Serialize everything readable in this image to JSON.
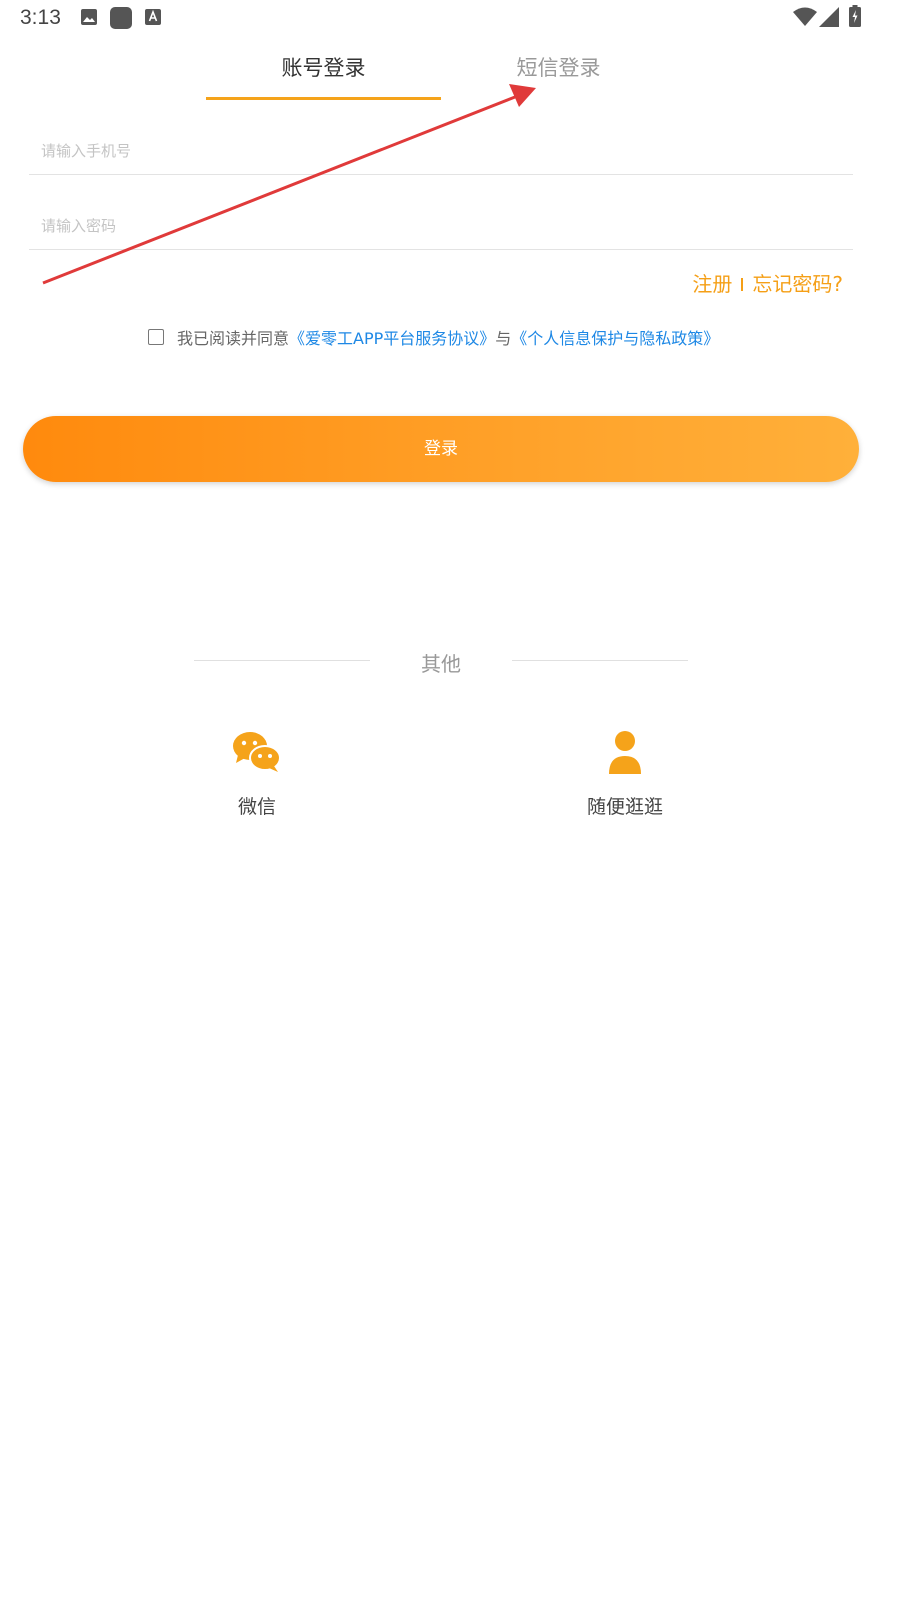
{
  "status_bar": {
    "time": "3:13"
  },
  "tabs": [
    {
      "label": "账号登录",
      "active": true
    },
    {
      "label": "短信登录",
      "active": false
    }
  ],
  "form": {
    "phone_placeholder": "请输入手机号",
    "password_placeholder": "请输入密码"
  },
  "links": {
    "register": "注册",
    "forgot": "忘记密码?"
  },
  "agreement": {
    "checked": false,
    "prefix": "我已阅读并同意",
    "service_link": "《爱零工APP平台服务协议》",
    "conjunction": "与",
    "privacy_link": "《个人信息保护与隐私政策》"
  },
  "login_button": {
    "label": "登录"
  },
  "other": {
    "label": "其他",
    "options": [
      {
        "label": "微信",
        "icon": "wechat-icon"
      },
      {
        "label": "随便逛逛",
        "icon": "user-icon"
      }
    ]
  },
  "colors": {
    "accent": "#f5a31a",
    "link": "#1e88e5",
    "annotation": "#e03a3a"
  }
}
